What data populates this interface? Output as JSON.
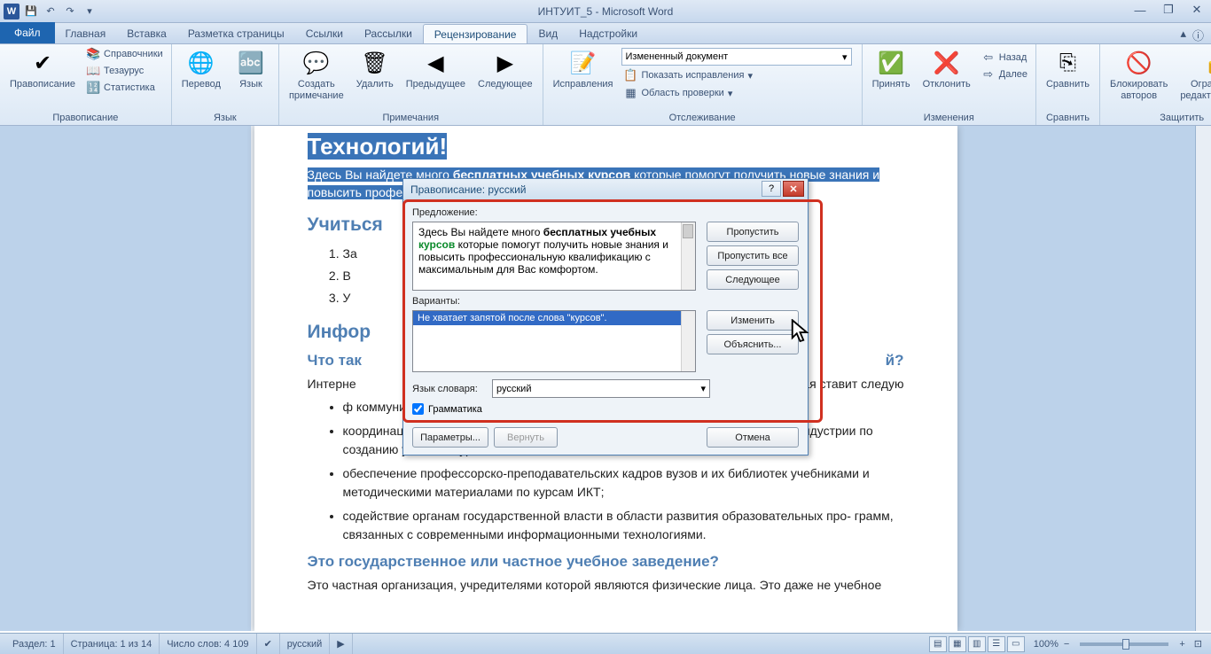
{
  "title": "ИНТУИТ_5 - Microsoft Word",
  "tabs": {
    "file": "Файл",
    "list": [
      "Главная",
      "Вставка",
      "Разметка страницы",
      "Ссылки",
      "Рассылки",
      "Рецензирование",
      "Вид",
      "Надстройки"
    ],
    "active_index": 5
  },
  "ribbon": {
    "g1": {
      "label": "Правописание",
      "btn": "Правописание",
      "items": [
        "Справочники",
        "Тезаурус",
        "Статистика"
      ]
    },
    "g2": {
      "label": "Язык",
      "btn1": "Перевод",
      "btn2": "Язык"
    },
    "g3": {
      "label": "Примечания",
      "btn1": "Создать\nпримечание",
      "btn2": "Удалить",
      "btn3": "Предыдущее",
      "btn4": "Следующее"
    },
    "g4": {
      "label": "Отслеживание",
      "btn": "Исправления",
      "dropdown": "Измененный документ",
      "items": [
        "Показать исправления",
        "Область проверки"
      ]
    },
    "g5": {
      "label": "Изменения",
      "btn1": "Принять",
      "btn2": "Отклонить",
      "items": [
        "Назад",
        "Далее"
      ]
    },
    "g6": {
      "label": "Сравнить",
      "btn": "Сравнить"
    },
    "g7": {
      "label": "Защитить",
      "btn1": "Блокировать\nавторов",
      "btn2": "Ограничить\nредактирование"
    }
  },
  "document": {
    "h1": "Технологий!",
    "p1_a": "Здесь Вы найдете много ",
    "p1_b": "бесплатных учебных ",
    "p1_c": "курсов",
    "p1_d": " которые помогут получить новые знания и повысить профессиональную квалификацию с максимальным для Вас комфортом.",
    "h2a": "Учиться",
    "li1": "За",
    "li2": "В",
    "li3": "У",
    "h2b": "Инфор",
    "h3a": "Что так",
    "h3a_end": "й?",
    "p2a": "Интерне",
    "p2b": "торая ставит следую",
    "ul1": "ф                                                     коммуникационных технологий;",
    "ul2": "координация учебно-методической деятельности предприятий компьютерной индустрии по созданию учебных курсов по ИКТ;",
    "ul3": "обеспечение профессорско-преподавательских кадров вузов и их библиотек учебниками и методическими материалами по курсам ИКТ;",
    "ul4": "содействие органам государственной власти в области развития образовательных про- грамм, связанных с современными информационными технологиями.",
    "h3b": "Это государственное или частное учебное заведение?",
    "p3": "Это частная организация, учредителями которой являются физические лица. Это даже не учебное"
  },
  "dialog": {
    "title": "Правописание: русский",
    "lbl_sentence": "Предложение:",
    "sentence_a": "Здесь Вы найдете много ",
    "sentence_b": "бесплатных учебных ",
    "sentence_c": "курсов",
    "sentence_d": " которые помогут получить новые знания и повысить профессиональную квалификацию с максимальным для Вас комфортом.",
    "btn_skip": "Пропустить",
    "btn_skipall": "Пропустить все",
    "btn_next": "Следующее",
    "lbl_variants": "Варианты:",
    "variant": "Не хватает запятой после слова \"курсов\".",
    "btn_change": "Изменить",
    "btn_explain": "Объяснить...",
    "lbl_lang": "Язык словаря:",
    "lang_value": "русский",
    "chk_grammar": "Грамматика",
    "btn_params": "Параметры...",
    "btn_revert": "Вернуть",
    "btn_cancel": "Отмена"
  },
  "status": {
    "section": "Раздел: 1",
    "page": "Страница: 1 из 14",
    "words": "Число слов: 4 109",
    "lang": "русский",
    "zoom": "100%"
  }
}
